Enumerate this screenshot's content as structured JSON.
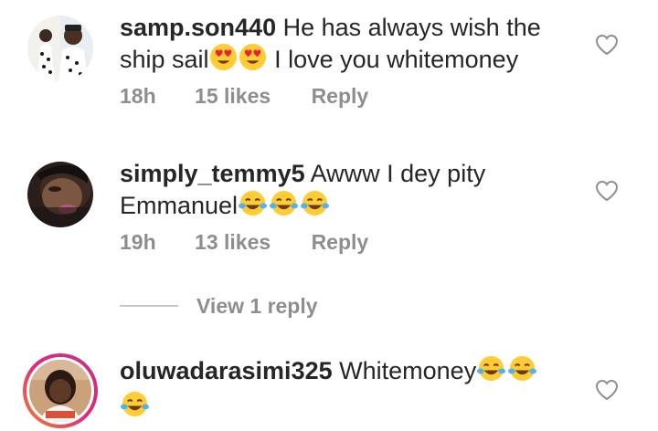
{
  "comments": [
    {
      "username": "samp.son440",
      "text_line1": "He has always wish the",
      "text_line2_before": "ship sail",
      "text_line2_after": "I love you whitemoney",
      "emoji": "heart-eyes",
      "time": "18h",
      "likes": "15 likes",
      "reply": "Reply"
    },
    {
      "username": "simply_temmy5",
      "text_line1": "Awww I dey pity",
      "text_line2": "Emmanuel",
      "emoji": "tears-of-joy",
      "time": "19h",
      "likes": "13 likes",
      "reply": "Reply"
    },
    {
      "username": "oluwadarasimi325",
      "text_line1": "Whitemoney",
      "emoji": "tears-of-joy"
    }
  ],
  "view_replies": "View 1 reply",
  "icons": {
    "like": "heart-outline-icon"
  },
  "colors": {
    "meta_text": "#8e8e8e",
    "story_ring_start": "#f58529",
    "story_ring_end": "#dd2a7b"
  }
}
